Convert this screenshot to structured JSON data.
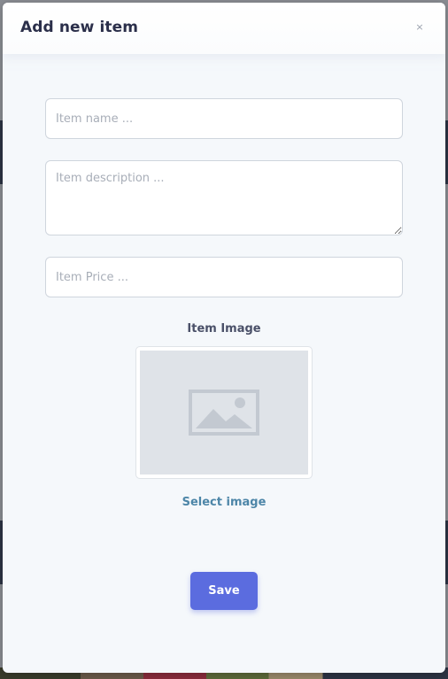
{
  "modal": {
    "title": "Add new item",
    "close_glyph": "×"
  },
  "form": {
    "name_placeholder": "Item name ...",
    "description_placeholder": "Item description ...",
    "price_placeholder": "Item Price ...",
    "image_label": "Item Image",
    "image_placeholder_icon": "image-placeholder-icon",
    "select_image_label": "Select image",
    "save_label": "Save"
  },
  "colors": {
    "accent": "#5b6cdf",
    "link": "#4d86a8",
    "title": "#2b2f4a",
    "modal_bg": "#f5f8fb"
  }
}
